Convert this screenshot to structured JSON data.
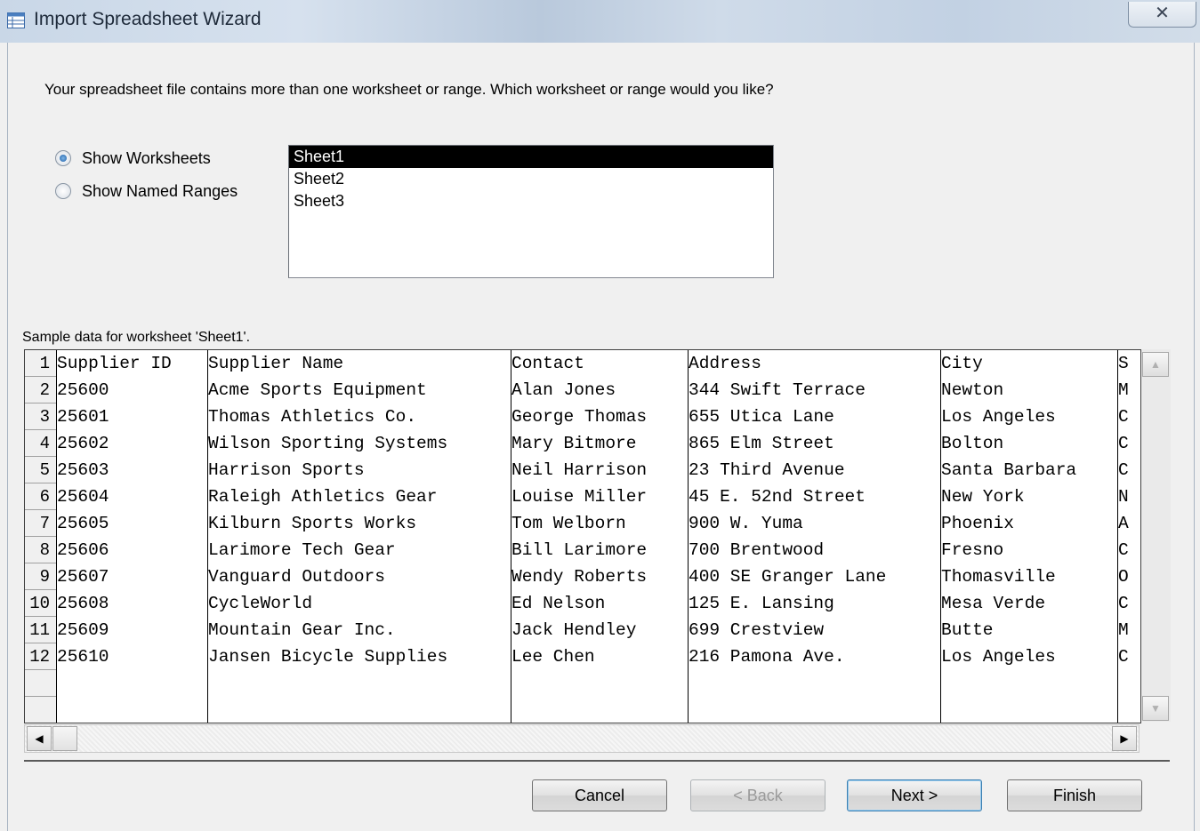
{
  "window": {
    "title": "Import Spreadsheet Wizard",
    "close_glyph": "✕"
  },
  "prompt": "Your spreadsheet file contains more than one worksheet or range. Which worksheet or range would you like?",
  "options": {
    "show_worksheets": "Show Worksheets",
    "show_named_ranges": "Show Named Ranges",
    "selected": "show_worksheets"
  },
  "sheets": {
    "items": [
      "Sheet1",
      "Sheet2",
      "Sheet3"
    ],
    "selected": "Sheet1"
  },
  "sample": {
    "label": "Sample data for worksheet 'Sheet1'.",
    "row_numbers": [
      "1",
      "2",
      "3",
      "4",
      "5",
      "6",
      "7",
      "8",
      "9",
      "10",
      "11",
      "12"
    ],
    "rows": [
      [
        "Supplier ID",
        "Supplier Name",
        "Contact",
        "Address",
        "City",
        "S"
      ],
      [
        "25600",
        "Acme Sports Equipment",
        "Alan Jones",
        "344 Swift Terrace",
        "Newton",
        "M"
      ],
      [
        "25601",
        "Thomas Athletics Co.",
        "George Thomas",
        "655 Utica Lane",
        "Los Angeles",
        "C"
      ],
      [
        "25602",
        "Wilson Sporting Systems",
        "Mary Bitmore",
        "865 Elm Street",
        "Bolton",
        "C"
      ],
      [
        "25603",
        "Harrison Sports",
        "Neil Harrison",
        "23 Third Avenue",
        "Santa Barbara",
        "C"
      ],
      [
        "25604",
        "Raleigh Athletics Gear",
        "Louise Miller",
        "45 E. 52nd Street",
        "New York",
        "N"
      ],
      [
        "25605",
        "Kilburn Sports Works",
        "Tom Welborn",
        "900 W. Yuma",
        "Phoenix",
        "A"
      ],
      [
        "25606",
        "Larimore Tech Gear",
        "Bill Larimore",
        "700 Brentwood",
        "Fresno",
        "C"
      ],
      [
        "25607",
        "Vanguard Outdoors",
        "Wendy Roberts",
        "400 SE Granger Lane",
        "Thomasville",
        "O"
      ],
      [
        "25608",
        "CycleWorld",
        "Ed Nelson",
        "125 E. Lansing",
        "Mesa Verde",
        "C"
      ],
      [
        "25609",
        "Mountain Gear Inc.",
        "Jack Hendley",
        "699 Crestview",
        "Butte",
        "M"
      ],
      [
        "25610",
        "Jansen Bicycle Supplies",
        "Lee Chen",
        "216 Pamona Ave.",
        "Los Angeles",
        "C"
      ]
    ]
  },
  "buttons": {
    "cancel": "Cancel",
    "back": "< Back",
    "next": "Next >",
    "finish": "Finish"
  }
}
